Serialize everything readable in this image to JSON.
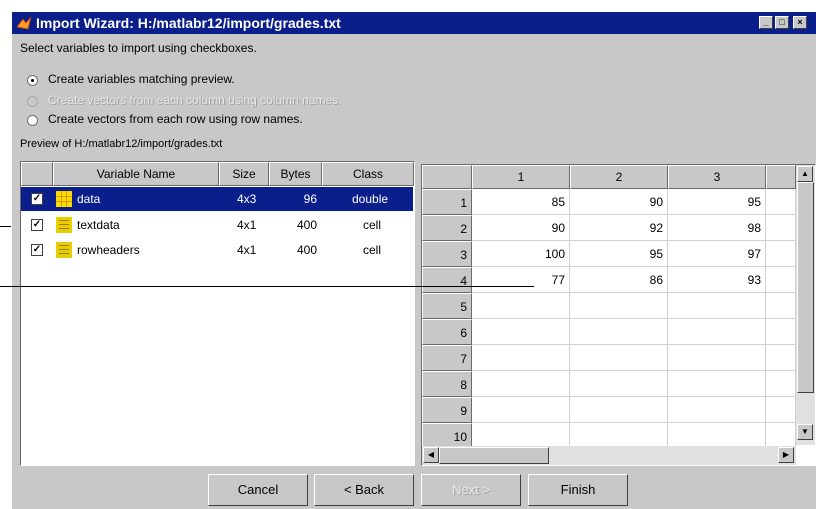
{
  "window": {
    "title": "Import Wizard: H:/matlabr12/import/grades.txt",
    "controls": [
      "_",
      "□",
      "×"
    ]
  },
  "instruction": "Select variables to import using checkboxes.",
  "options": [
    {
      "label": "Create variables matching preview.",
      "selected": true,
      "enabled": true
    },
    {
      "label": "Create vectors from each column using column names.",
      "selected": false,
      "enabled": false
    },
    {
      "label": "Create vectors from each row using row names.",
      "selected": false,
      "enabled": true
    }
  ],
  "preview_label": "Preview of H:/matlabr12/import/grades.txt",
  "variables": {
    "columns": [
      "Variable Name",
      "Size",
      "Bytes",
      "Class"
    ],
    "rows": [
      {
        "checked": "✓",
        "icon": "matrix-icon",
        "name": "data",
        "size": "4x3",
        "bytes": "96",
        "class": "double",
        "selected": true
      },
      {
        "checked": "✓",
        "icon": "cell-array-icon",
        "name": "textdata",
        "size": "4x1",
        "bytes": "400",
        "class": "cell",
        "selected": false
      },
      {
        "checked": "✓",
        "icon": "cell-array-icon",
        "name": "rowheaders",
        "size": "4x1",
        "bytes": "400",
        "class": "cell",
        "selected": false
      }
    ]
  },
  "grid": {
    "col_headers": [
      "1",
      "2",
      "3"
    ],
    "row_headers": [
      "1",
      "2",
      "3",
      "4",
      "5",
      "6",
      "7",
      "8",
      "9",
      "10"
    ],
    "cells": [
      [
        "85",
        "90",
        "95"
      ],
      [
        "90",
        "92",
        "98"
      ],
      [
        "100",
        "95",
        "97"
      ],
      [
        "77",
        "86",
        "93"
      ],
      [
        "",
        "",
        ""
      ],
      [
        "",
        "",
        ""
      ],
      [
        "",
        "",
        ""
      ],
      [
        "",
        "",
        ""
      ],
      [
        "",
        "",
        ""
      ],
      [
        "",
        "",
        ""
      ]
    ]
  },
  "buttons": {
    "cancel": "Cancel",
    "back": "< Back",
    "next": "Next >",
    "finish": "Finish"
  },
  "colors": {
    "titlebar": "#0a1f8c",
    "selection": "#0a1f8c",
    "face": "#c8c8c8"
  }
}
